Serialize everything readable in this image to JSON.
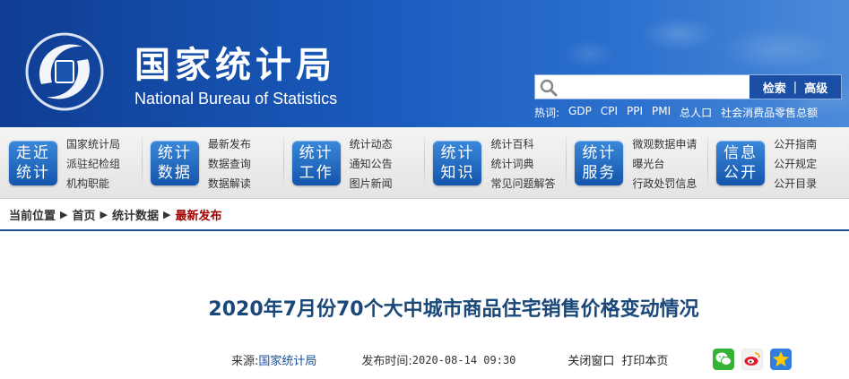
{
  "header": {
    "org_cn": "国家统计局",
    "org_en": "National Bureau of Statistics",
    "search": {
      "placeholder": "",
      "search_label": "检索",
      "separator": "|",
      "advanced_label": "高级"
    },
    "hotwords_label": "热词:",
    "hotwords": [
      "GDP",
      "CPI",
      "PPI",
      "PMI",
      "总人口",
      "社会消费品零售总额"
    ]
  },
  "nav": [
    {
      "badge": [
        "走近",
        "统计"
      ],
      "links": [
        "国家统计局",
        "派驻纪检组",
        "机构职能"
      ]
    },
    {
      "badge": [
        "统计",
        "数据"
      ],
      "links": [
        "最新发布",
        "数据查询",
        "数据解读"
      ]
    },
    {
      "badge": [
        "统计",
        "工作"
      ],
      "links": [
        "统计动态",
        "通知公告",
        "图片新闻"
      ]
    },
    {
      "badge": [
        "统计",
        "知识"
      ],
      "links": [
        "统计百科",
        "统计词典",
        "常见问题解答"
      ]
    },
    {
      "badge": [
        "统计",
        "服务"
      ],
      "links": [
        "微观数据申请",
        "曝光台",
        "行政处罚信息"
      ]
    },
    {
      "badge": [
        "信息",
        "公开"
      ],
      "links": [
        "公开指南",
        "公开规定",
        "公开目录"
      ]
    }
  ],
  "breadcrumb": {
    "items": [
      "当前位置",
      "首页",
      "统计数据"
    ],
    "current": "最新发布"
  },
  "article": {
    "title": "2020年7月份70个大中城市商品住宅销售价格变动情况",
    "source_label": "来源:",
    "source": "国家统计局",
    "time_label": "发布时间:",
    "time": "2020-08-14 09:30",
    "close_window": "关闭窗口",
    "print_page": "打印本页"
  },
  "share_icons": [
    "wechat-icon",
    "weibo-icon",
    "qzone-icon"
  ]
}
